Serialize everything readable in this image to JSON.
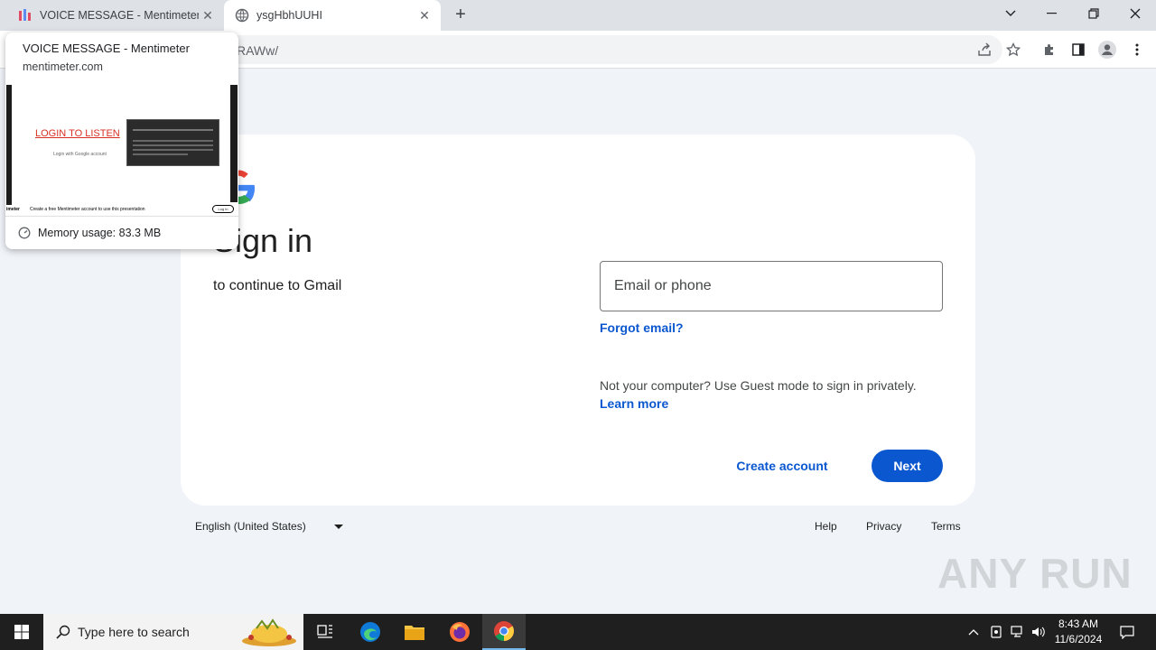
{
  "browser": {
    "tabs": [
      {
        "title": "VOICE MESSAGE - Mentimeter",
        "active": false
      },
      {
        "title": "ysgHbhUUHI",
        "active": true
      }
    ],
    "new_tab": "+",
    "url_visible": "RAWw/"
  },
  "hover_card": {
    "title": "VOICE MESSAGE - Mentimeter",
    "domain": "mentimeter.com",
    "preview": {
      "login_text": "LOGIN TO LISTEN",
      "sub_text": "Login with Google account",
      "bottom_left": "imeter",
      "bottom_text": "Create a free Mentimeter account to use this presentation",
      "bottom_btn": "Log in"
    },
    "memory": "Memory usage: 83.3 MB"
  },
  "page": {
    "heading": "Sign in",
    "subheading": "to continue to Gmail",
    "email_placeholder": "Email or phone",
    "forgot_email": "Forgot email?",
    "guest_text": "Not your computer? Use Guest mode to sign in privately.",
    "learn_more": "Learn more",
    "create_account": "Create account",
    "next": "Next"
  },
  "footer": {
    "language": "English (United States)",
    "help": "Help",
    "privacy": "Privacy",
    "terms": "Terms"
  },
  "watermark": "ANY RUN",
  "taskbar": {
    "search_placeholder": "Type here to search",
    "time": "8:43 AM",
    "date": "11/6/2024"
  },
  "colors": {
    "accent": "#0b57d0",
    "page_bg": "#f0f4f9",
    "taskbar_bg": "#1f1f1f"
  }
}
